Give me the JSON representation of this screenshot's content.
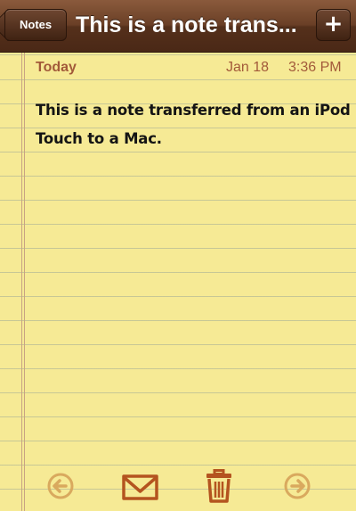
{
  "navbar": {
    "back_label": "Notes",
    "title": "This is a note trans...",
    "add_label": "+"
  },
  "note": {
    "day": "Today",
    "date": "Jan 18",
    "time": "3:36 PM",
    "body": "This is a note transferred from an iPod Touch to a Mac."
  },
  "toolbar": {
    "icons": [
      "previous-arrow-icon",
      "mail-icon",
      "trash-icon",
      "next-arrow-icon"
    ]
  },
  "colors": {
    "paper": "#f6ea95",
    "nav": "#6a3f26",
    "date_text": "#a25a3a",
    "icon": "#b4541f"
  }
}
